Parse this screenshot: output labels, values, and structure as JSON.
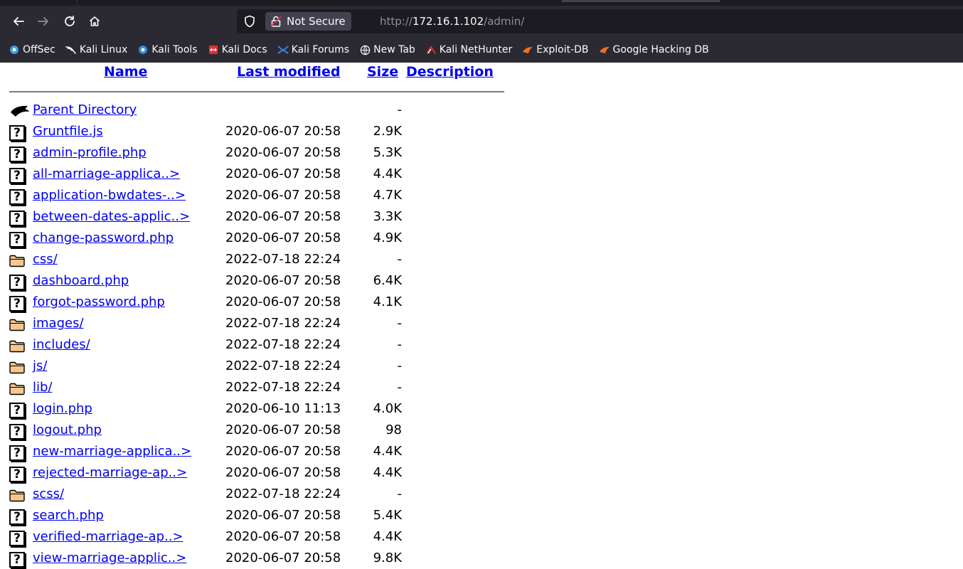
{
  "browser": {
    "security_label": "Not Secure",
    "url_scheme": "http://",
    "url_host": "172.16.1.102",
    "url_path": "/admin/"
  },
  "bookmarks": [
    {
      "label": "OffSec",
      "icon": "offsec-icon",
      "color": "#3aa0e8"
    },
    {
      "label": "Kali Linux",
      "icon": "kali-dragon-icon",
      "color": "#ffffff"
    },
    {
      "label": "Kali Tools",
      "icon": "kali-tools-icon",
      "color": "#2f8fe0"
    },
    {
      "label": "Kali Docs",
      "icon": "kali-docs-icon",
      "color": "#e03030"
    },
    {
      "label": "Kali Forums",
      "icon": "kali-forums-icon",
      "color": "#3a7de0"
    },
    {
      "label": "New Tab",
      "icon": "globe-icon",
      "color": "#fbfbfe"
    },
    {
      "label": "Kali NetHunter",
      "icon": "nethunter-icon",
      "color": "#e03030"
    },
    {
      "label": "Exploit-DB",
      "icon": "exploit-db-icon",
      "color": "#f07020"
    },
    {
      "label": "Google Hacking DB",
      "icon": "ghdb-icon",
      "color": "#f07020"
    }
  ],
  "listing": {
    "headers": {
      "name": "Name",
      "last_modified": "Last modified",
      "size": "Size",
      "description": "Description"
    },
    "rows": [
      {
        "name": "Parent Directory",
        "modified": "",
        "size": "-",
        "type": "parent"
      },
      {
        "name": "Gruntfile.js",
        "modified": "2020-06-07 20:58",
        "size": "2.9K",
        "type": "file"
      },
      {
        "name": "admin-profile.php",
        "modified": "2020-06-07 20:58",
        "size": "5.3K",
        "type": "file"
      },
      {
        "name": "all-marriage-applica..>",
        "modified": "2020-06-07 20:58",
        "size": "4.4K",
        "type": "file"
      },
      {
        "name": "application-bwdates-..>",
        "modified": "2020-06-07 20:58",
        "size": "4.7K",
        "type": "file"
      },
      {
        "name": "between-dates-applic..>",
        "modified": "2020-06-07 20:58",
        "size": "3.3K",
        "type": "file"
      },
      {
        "name": "change-password.php",
        "modified": "2020-06-07 20:58",
        "size": "4.9K",
        "type": "file"
      },
      {
        "name": "css/",
        "modified": "2022-07-18 22:24",
        "size": "-",
        "type": "folder"
      },
      {
        "name": "dashboard.php",
        "modified": "2020-06-07 20:58",
        "size": "6.4K",
        "type": "file"
      },
      {
        "name": "forgot-password.php",
        "modified": "2020-06-07 20:58",
        "size": "4.1K",
        "type": "file"
      },
      {
        "name": "images/",
        "modified": "2022-07-18 22:24",
        "size": "-",
        "type": "folder"
      },
      {
        "name": "includes/",
        "modified": "2022-07-18 22:24",
        "size": "-",
        "type": "folder"
      },
      {
        "name": "js/",
        "modified": "2022-07-18 22:24",
        "size": "-",
        "type": "folder"
      },
      {
        "name": "lib/",
        "modified": "2022-07-18 22:24",
        "size": "-",
        "type": "folder"
      },
      {
        "name": "login.php",
        "modified": "2020-06-10 11:13",
        "size": "4.0K",
        "type": "file"
      },
      {
        "name": "logout.php",
        "modified": "2020-06-07 20:58",
        "size": "98",
        "type": "file"
      },
      {
        "name": "new-marriage-applica..>",
        "modified": "2020-06-07 20:58",
        "size": "4.4K",
        "type": "file"
      },
      {
        "name": "rejected-marriage-ap..>",
        "modified": "2020-06-07 20:58",
        "size": "4.4K",
        "type": "file"
      },
      {
        "name": "scss/",
        "modified": "2022-07-18 22:24",
        "size": "-",
        "type": "folder"
      },
      {
        "name": "search.php",
        "modified": "2020-06-07 20:58",
        "size": "5.4K",
        "type": "file"
      },
      {
        "name": "verified-marriage-ap..>",
        "modified": "2020-06-07 20:58",
        "size": "4.4K",
        "type": "file"
      },
      {
        "name": "view-marriage-applic..>",
        "modified": "2020-06-07 20:58",
        "size": "9.8K",
        "type": "file"
      }
    ]
  }
}
